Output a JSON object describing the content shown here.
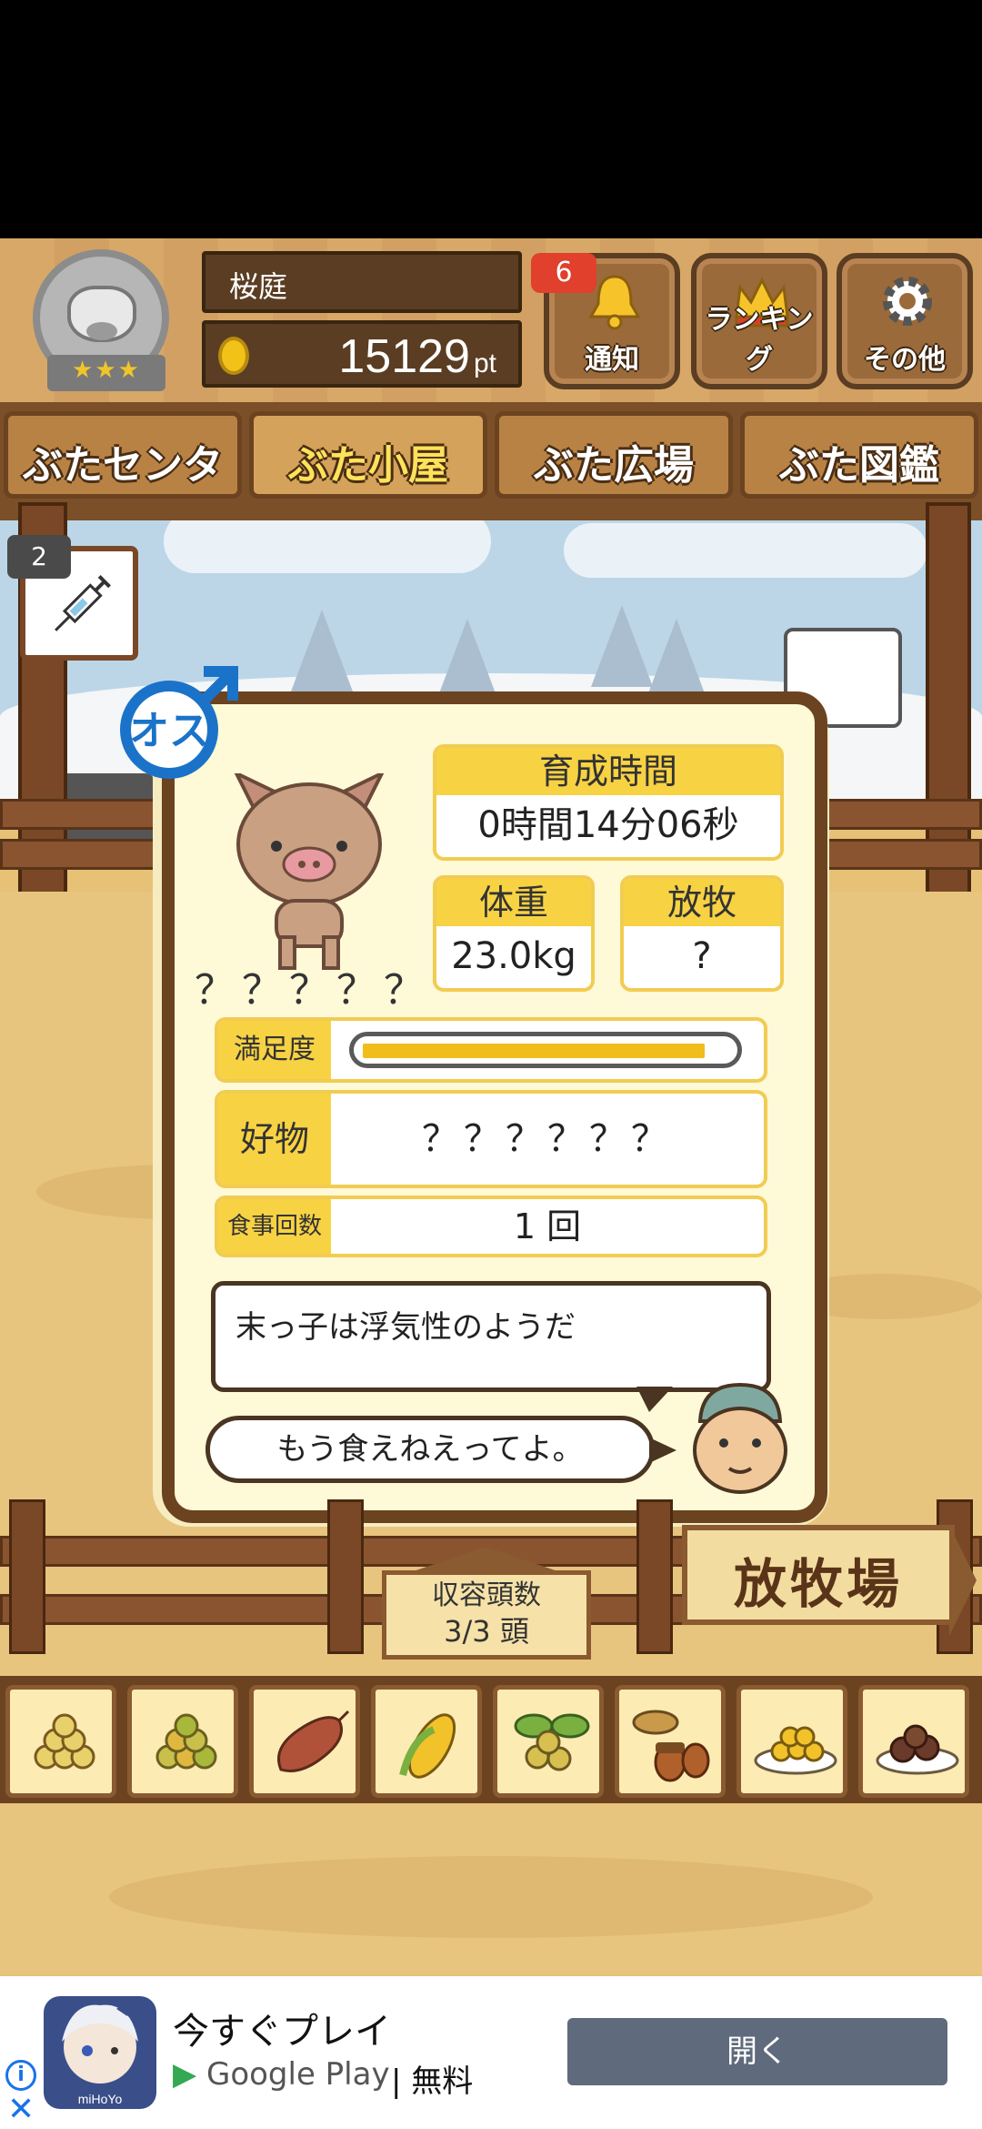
{
  "header": {
    "player_name": "桜庭",
    "points": "15129",
    "points_unit": "pt",
    "notification_count": "6",
    "notification_label": "通知",
    "ranking_label": "ランキング",
    "settings_label": "その他",
    "rank_stars": "★★★"
  },
  "tabs": [
    {
      "label": "ぶたセンター",
      "active": false
    },
    {
      "label": "ぶた小屋",
      "active": true
    },
    {
      "label": "ぶた広場",
      "active": false
    },
    {
      "label": "ぶた図鑑",
      "active": false
    }
  ],
  "item": {
    "count": "2",
    "icon": "syringe-icon"
  },
  "pig": {
    "gender_label": "オス",
    "name": "？？？？？",
    "grow_time_label": "育成時間",
    "grow_time_value": "0時間14分06秒",
    "weight_label": "体重",
    "weight_value": "23.0kg",
    "free_label": "放牧",
    "free_value": "?",
    "satisfaction_label": "満足度",
    "satisfaction_level": 0.96,
    "favorite_label": "好物",
    "favorite_value": "？？？？？？",
    "meal_label": "食事回数",
    "meal_value": "1 回",
    "comment1": "末っ子は浮気性のようだ",
    "comment2": "もう食えねえってよ。"
  },
  "pen": {
    "capacity_label": "収容頭数",
    "capacity_value": "3/3 頭",
    "ranch_sign": "放牧場"
  },
  "foods": [
    "grain-pile-icon",
    "grain-mix-icon",
    "sweet-potato-icon",
    "corn-icon",
    "beans-leaves-icon",
    "acorn-icon",
    "grain-plate-icon",
    "meatballs-plate-icon"
  ],
  "ad": {
    "title": "今すぐプレイ",
    "store": "Google Play",
    "price": "無料",
    "open_label": "開く",
    "icon_label": "miHoYo"
  },
  "colors": {
    "accent_yellow": "#f7d243",
    "wood_dark": "#6b4320",
    "satisfaction_fill": "#f1bd1a"
  }
}
